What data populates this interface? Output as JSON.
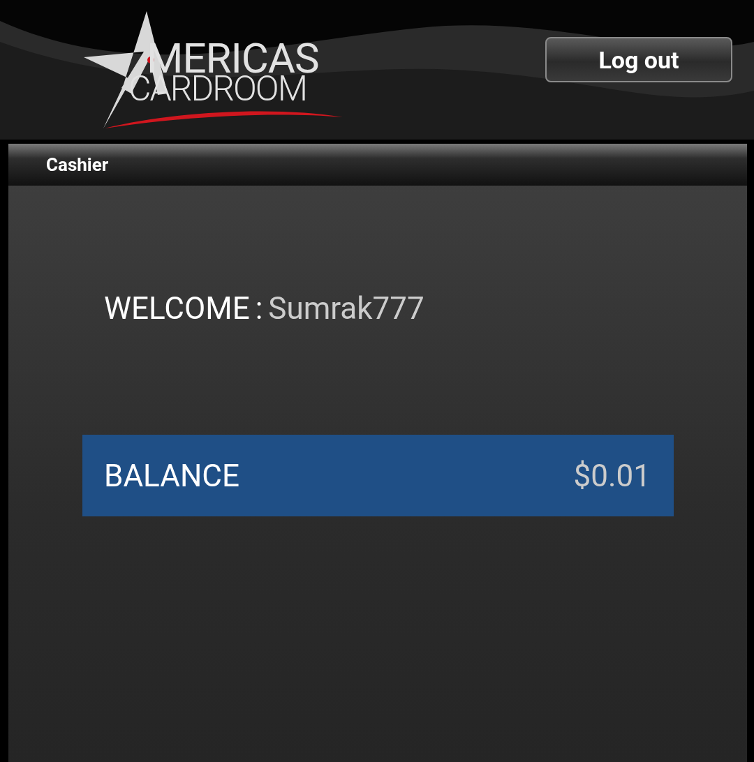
{
  "logo": {
    "lines": [
      "MERICAS",
      "CARDROOM"
    ]
  },
  "header": {
    "logout_button": "Log out"
  },
  "panel": {
    "title": "Cashier"
  },
  "welcome": {
    "label": "WELCOME",
    "separator": ":",
    "username": "Sumrak777"
  },
  "balance": {
    "label": "BALANCE",
    "amount": "$0.01"
  }
}
